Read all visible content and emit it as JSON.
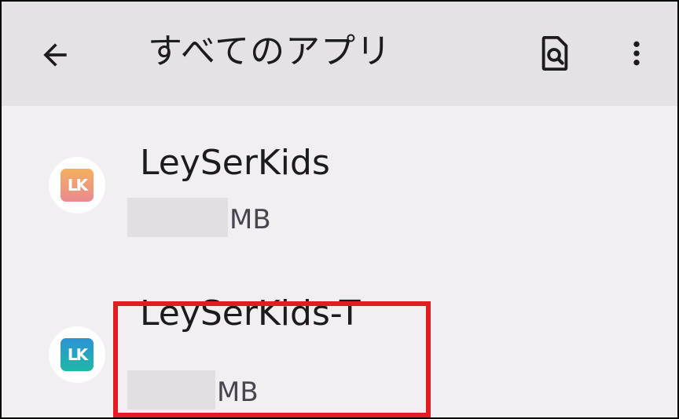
{
  "app_bar": {
    "title": "すべてのアプリ",
    "back_icon": "arrow-back-icon",
    "search_icon": "document-search-icon",
    "more_icon": "more-vert-icon"
  },
  "apps": [
    {
      "name": "LeySerKids",
      "icon_text": "LK",
      "size_unit": "MB",
      "icon_colors": [
        "#f4b05e",
        "#ea8a8f"
      ]
    },
    {
      "name": "LeySerKids-T",
      "icon_text": "LK",
      "size_unit": "MB",
      "icon_colors": [
        "#2b93d6",
        "#1fb8a7"
      ],
      "highlighted": true
    }
  ],
  "colors": {
    "app_bar_bg": "#e5e2e6",
    "page_bg": "#f2eff3",
    "highlight": "#e21c22"
  }
}
